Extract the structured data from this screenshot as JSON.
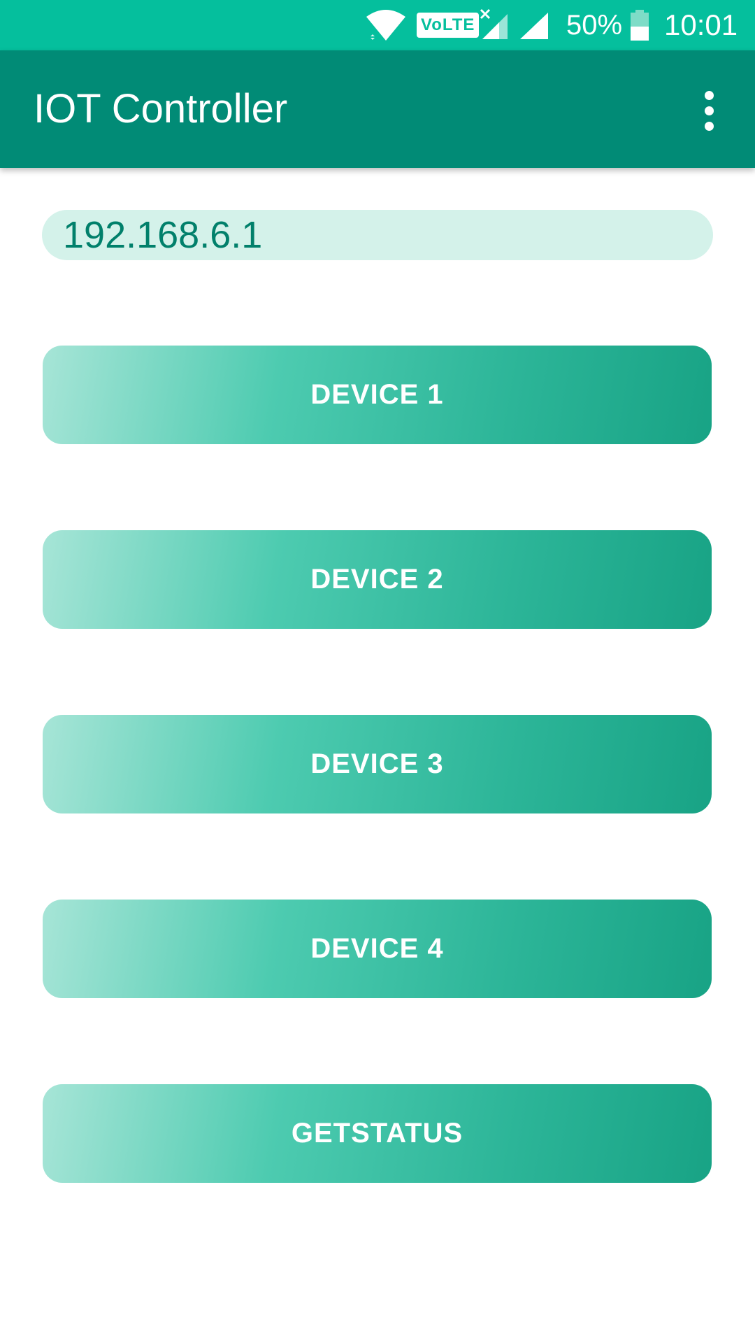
{
  "status_bar": {
    "volte": "VoLTE",
    "battery": "50%",
    "time": "10:01",
    "icons": [
      "wifi-icon",
      "volte-icon",
      "signal-no-sim-icon",
      "signal-icon",
      "battery-icon"
    ]
  },
  "app_bar": {
    "title": "IOT Controller",
    "menu_icon": "more-vert-icon"
  },
  "ip_field": {
    "value": "192.168.6.1"
  },
  "buttons": [
    {
      "label": "DEVICE 1"
    },
    {
      "label": "DEVICE 2"
    },
    {
      "label": "DEVICE 3"
    },
    {
      "label": "DEVICE 4"
    },
    {
      "label": "GETSTATUS"
    }
  ],
  "colors": {
    "status_bar": "#05BF9D",
    "app_bar": "#018B76",
    "input_bg": "#D4F2EA",
    "input_text": "#01806B",
    "button_gradient_start": "#A7E5D7",
    "button_gradient_end": "#18A385"
  }
}
